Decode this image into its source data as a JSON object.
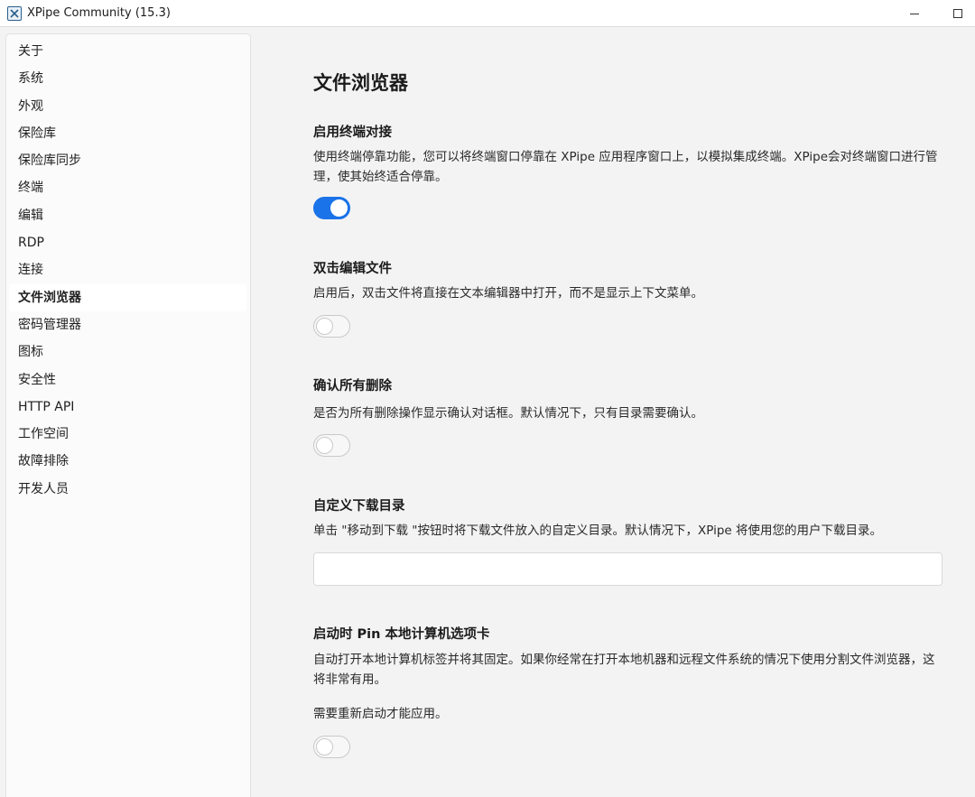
{
  "window": {
    "title": "XPipe Community (15.3)",
    "icon": "xpipe-logo-icon",
    "minimize_icon": "minimize-icon",
    "maximize_icon": "maximize-icon"
  },
  "sidebar": {
    "items": [
      {
        "label": "关于",
        "active": false
      },
      {
        "label": "系统",
        "active": false
      },
      {
        "label": "外观",
        "active": false
      },
      {
        "label": "保险库",
        "active": false
      },
      {
        "label": "保险库同步",
        "active": false
      },
      {
        "label": "终端",
        "active": false
      },
      {
        "label": "编辑",
        "active": false
      },
      {
        "label": "RDP",
        "active": false
      },
      {
        "label": "连接",
        "active": false
      },
      {
        "label": "文件浏览器",
        "active": true
      },
      {
        "label": "密码管理器",
        "active": false
      },
      {
        "label": "图标",
        "active": false
      },
      {
        "label": "安全性",
        "active": false
      },
      {
        "label": "HTTP API",
        "active": false
      },
      {
        "label": "工作空间",
        "active": false
      },
      {
        "label": "故障排除",
        "active": false
      },
      {
        "label": "开发人员",
        "active": false
      }
    ]
  },
  "main": {
    "page_title": "文件浏览器",
    "terminal_docking": {
      "title": "启用终端对接",
      "description": "使用终端停靠功能，您可以将终端窗口停靠在 XPipe 应用程序窗口上，以模拟集成终端。XPipe会对终端窗口进行管理，使其始终适合停靠。",
      "enabled": true
    },
    "double_click_edit": {
      "title": "双击编辑文件",
      "description": "启用后，双击文件将直接在文本编辑器中打开，而不是显示上下文菜单。",
      "enabled": false
    },
    "confirm_deletions": {
      "title": "确认所有删除",
      "description": "是否为所有删除操作显示确认对话框。默认情况下，只有目录需要确认。",
      "enabled": false
    },
    "download_directory": {
      "title": "自定义下载目录",
      "description": "单击 \"移动到下载 \"按钮时将下载文件放入的自定义目录。默认情况下，XPipe 将使用您的用户下载目录。",
      "value": "",
      "placeholder": ""
    },
    "pin_local_tab": {
      "title": "启动时 Pin 本地计算机选项卡",
      "description": "自动打开本地计算机标签并将其固定。如果你经常在打开本地机器和远程文件系统的情况下使用分割文件浏览器，这将非常有用。",
      "restart_note": "需要重新启动才能应用。",
      "enabled": false
    }
  },
  "colors": {
    "accent": "#1a73e8",
    "background": "#f3f3f3",
    "sidebar_background": "#fbfbfb"
  }
}
